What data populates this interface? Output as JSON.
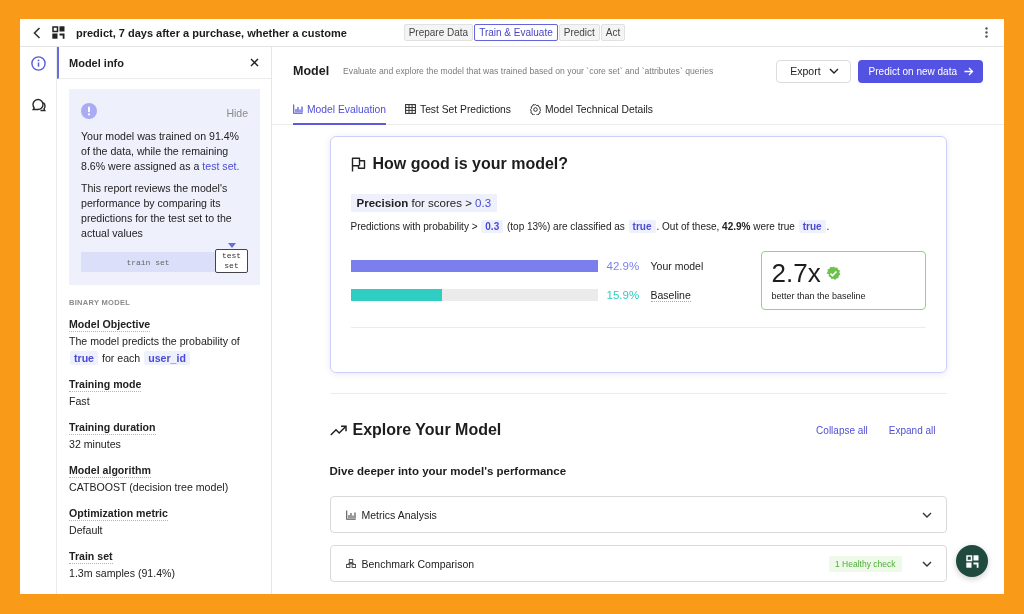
{
  "top_bar": {
    "title": "predict, 7 days after a purchase, whether a custome",
    "steps": [
      {
        "label": "Prepare Data",
        "selected": false
      },
      {
        "label": "Train & Evaluate",
        "selected": true
      },
      {
        "label": "Predict",
        "selected": false
      },
      {
        "label": "Act",
        "selected": false
      }
    ]
  },
  "rail": [
    {
      "kind": "info",
      "selected": true
    },
    {
      "kind": "chat",
      "selected": false
    }
  ],
  "sidebar": {
    "title": "Model info",
    "notice": {
      "hide": "Hide",
      "paragraphs": [
        [
          {
            "kind": "text",
            "text": "Your model was trained on 91.4% of the data, while the remaining 8.6% were assigned as a "
          },
          {
            "kind": "link",
            "text": "test set."
          }
        ],
        [
          {
            "kind": "text",
            "text": "This report reviews the model's performance by comparing its predictions for the test set to the actual values"
          }
        ]
      ],
      "split": {
        "train": "train set",
        "test": "test set"
      }
    },
    "section_label": "BINARY MODEL",
    "fields": [
      {
        "label": "Model Objective",
        "value": [
          {
            "kind": "text",
            "text": "The model predicts the probability of "
          },
          {
            "kind": "code",
            "text": "true"
          },
          {
            "kind": "text",
            "text": " for each "
          },
          {
            "kind": "code",
            "text": "user_id"
          }
        ]
      },
      {
        "label": "Training mode",
        "value": [
          {
            "kind": "text",
            "text": "Fast"
          }
        ]
      },
      {
        "label": "Training duration",
        "value": [
          {
            "kind": "text",
            "text": "32 minutes"
          }
        ]
      },
      {
        "label": "Model algorithm",
        "value": [
          {
            "kind": "text",
            "text": "CATBOOST (decision tree model)"
          }
        ]
      },
      {
        "label": "Optimization metric",
        "value": [
          {
            "kind": "text",
            "text": "Default"
          }
        ]
      },
      {
        "label": "Train set",
        "value": [
          {
            "kind": "text",
            "text": "1.3m samples (91.4%)"
          }
        ]
      }
    ]
  },
  "main": {
    "title": "Model",
    "subtitle": "Evaluate and explore the model that was trained based on your `core set` and `attributes` queries",
    "export": "Export",
    "predict": "Predict on new data",
    "tabs": [
      {
        "kind": "chart",
        "label": "Model Evaluation",
        "selected": true
      },
      {
        "kind": "table",
        "label": "Test Set Predictions",
        "selected": false
      },
      {
        "kind": "gear",
        "label": "Model Technical Details",
        "selected": false
      }
    ]
  },
  "evaluation": {
    "title": "How good is your model?",
    "precision": [
      {
        "kind": "bold",
        "text": "Precision"
      },
      {
        "kind": "text",
        "text": " for scores > "
      },
      {
        "kind": "value",
        "text": "0.3"
      }
    ],
    "description": [
      {
        "kind": "text",
        "text": "Predictions with probability > "
      },
      {
        "kind": "code",
        "text": "0.3"
      },
      {
        "kind": "text",
        "text": " (top 13%) are classified as "
      },
      {
        "kind": "code",
        "text": "true"
      },
      {
        "kind": "text",
        "text": ". Out of these, "
      },
      {
        "kind": "bold",
        "text": "42.9%"
      },
      {
        "kind": "text",
        "text": " were true "
      },
      {
        "kind": "code",
        "text": "true"
      },
      {
        "kind": "text",
        "text": "."
      }
    ],
    "comparison": [
      {
        "kind": "model",
        "value": "42.9%",
        "label": "Your model",
        "level": 1,
        "color": "#7b7fee"
      },
      {
        "kind": "baseline",
        "value": "15.9%",
        "label": "Baseline",
        "level": 0.37,
        "color": "#2fcdc2"
      }
    ],
    "result": {
      "value": "2.7x",
      "caption": "better than the baseline"
    }
  },
  "explore": {
    "title": "Explore Your Model",
    "actions": [
      "Collapse all",
      "Expand all"
    ],
    "subtitle": "Dive deeper into your model's performance",
    "sections": [
      {
        "kind": "metrics",
        "title": "Metrics Analysis",
        "expanded": false
      },
      {
        "kind": "benchmark",
        "title": "Benchmark Comparison",
        "badge": "1 Healthy check",
        "expanded": false
      }
    ]
  }
}
